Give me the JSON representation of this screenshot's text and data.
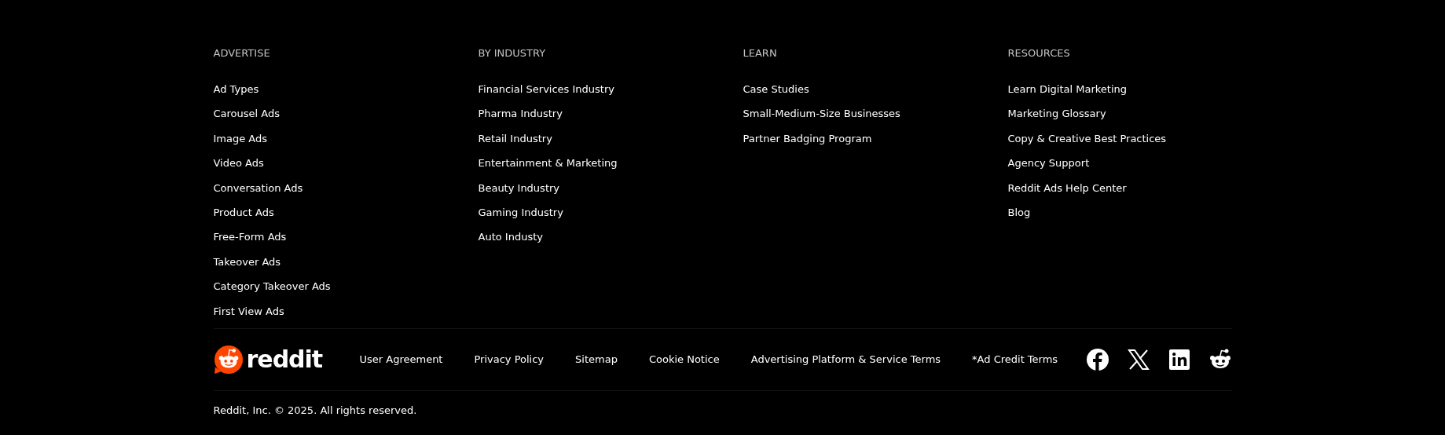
{
  "columns": [
    {
      "heading": "ADVERTISE",
      "links": [
        "Ad Types",
        "Carousel Ads",
        "Image Ads",
        "Video Ads",
        "Conversation Ads",
        "Product Ads",
        "Free-Form Ads",
        "Takeover Ads",
        "Category Takeover Ads",
        "First View Ads"
      ]
    },
    {
      "heading": "BY INDUSTRY",
      "links": [
        "Financial Services Industry",
        "Pharma Industry",
        "Retail Industry",
        "Entertainment & Marketing",
        "Beauty Industry",
        "Gaming Industry",
        "Auto Industy"
      ]
    },
    {
      "heading": "LEARN",
      "links": [
        "Case Studies",
        "Small-Medium-Size Businesses",
        "Partner Badging Program"
      ]
    },
    {
      "heading": "RESOURCES",
      "links": [
        "Learn Digital Marketing",
        "Marketing Glossary",
        "Copy & Creative Best Practices",
        "Agency Support",
        "Reddit Ads Help Center",
        "Blog"
      ]
    }
  ],
  "logo": {
    "wordmark": "reddit"
  },
  "legal_links": [
    "User Agreement",
    "Privacy Policy",
    "Sitemap",
    "Cookie Notice",
    "Advertising Platform & Service Terms",
    "*Ad Credit Terms"
  ],
  "social": [
    {
      "kind": "facebook"
    },
    {
      "kind": "x"
    },
    {
      "kind": "linkedin"
    },
    {
      "kind": "reddit"
    }
  ],
  "copyright": "Reddit, Inc. © 2025. All rights reserved."
}
